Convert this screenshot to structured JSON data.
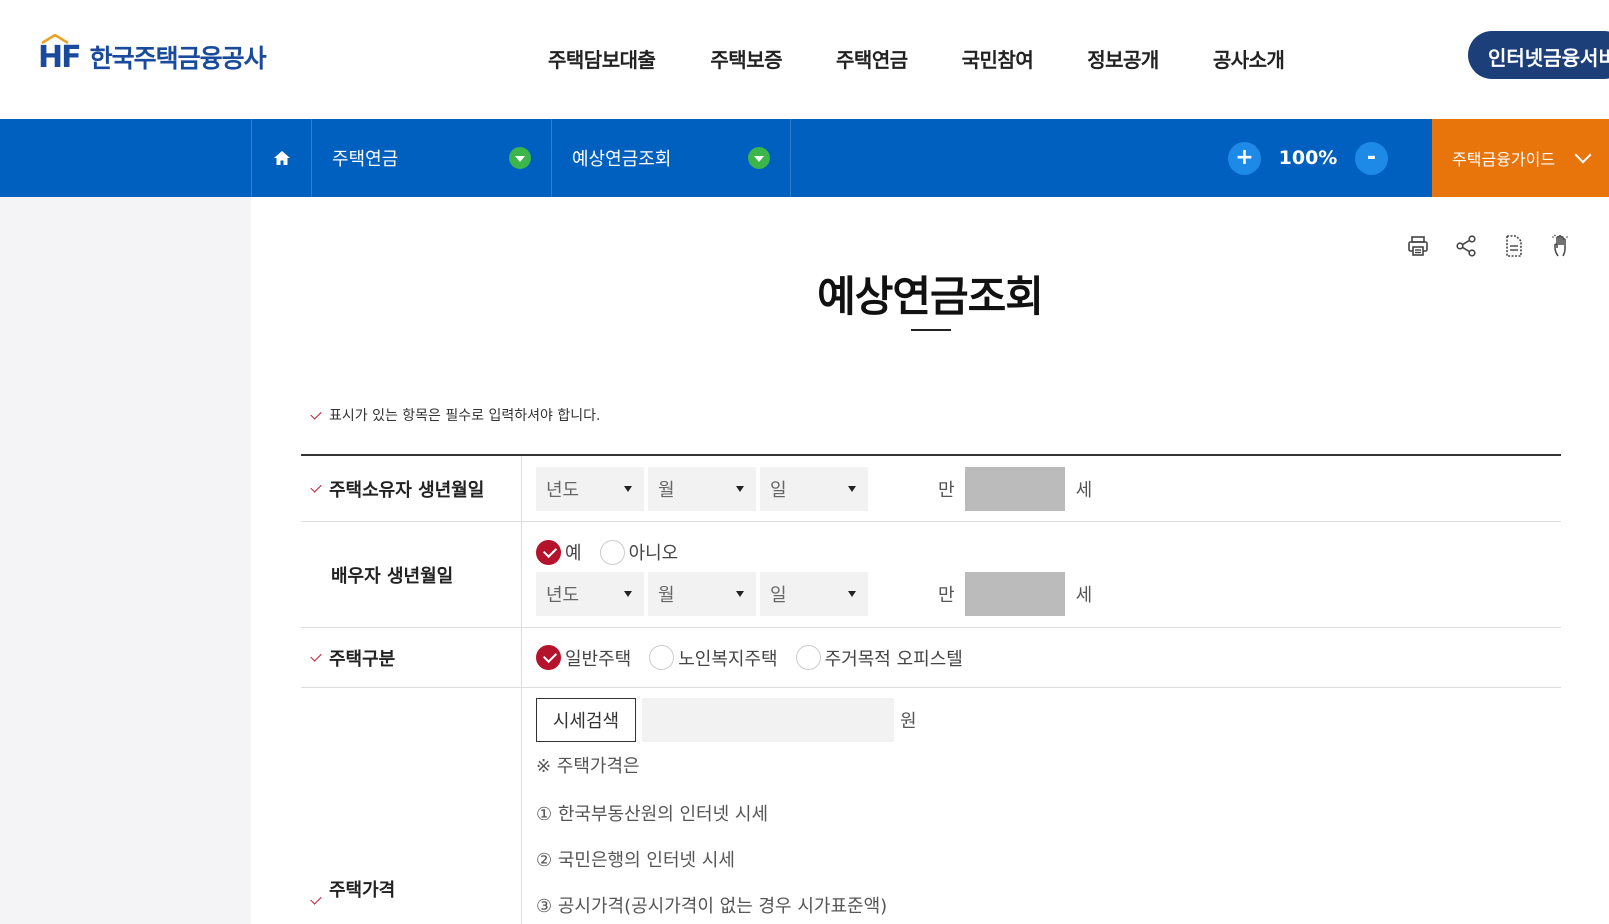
{
  "header": {
    "logo_mark": "HF",
    "logo_text": "한국주택금융공사",
    "nav": [
      "주택담보대출",
      "주택보증",
      "주택연금",
      "국민참여",
      "정보공개",
      "공사소개"
    ],
    "service_button": "인터넷금융서비스"
  },
  "locbar": {
    "menu1": "주택연금",
    "menu2": "예상연금조회",
    "zoom_in": "+",
    "zoom_value": "100%",
    "zoom_out": "-",
    "guide": "주택금융가이드"
  },
  "page": {
    "title": "예상연금조회",
    "required_note": "표시가 있는 항목은 필수로 입력하셔야 합니다."
  },
  "form": {
    "owner_birth": {
      "label": "주택소유자 생년월일",
      "year": "년도",
      "month": "월",
      "day": "일",
      "age_prefix": "만",
      "age_suffix": "세"
    },
    "spouse_birth": {
      "label": "배우자 생년월일",
      "radio_yes": "예",
      "radio_no": "아니오",
      "year": "년도",
      "month": "월",
      "day": "일",
      "age_prefix": "만",
      "age_suffix": "세"
    },
    "house_type": {
      "label": "주택구분",
      "options": [
        "일반주택",
        "노인복지주택",
        "주거목적 오피스텔"
      ]
    },
    "house_price": {
      "label": "주택가격",
      "search_button": "시세검색",
      "unit": "원",
      "note_title": "※ 주택가격은",
      "notes": [
        "① 한국부동산원의 인터넷 시세",
        "② 국민은행의 인터넷 시세",
        "③ 공시가격(공시가격이 없는 경우 시가표준액)"
      ]
    }
  },
  "colors": {
    "primary_blue": "#0060c0",
    "guide_orange": "#e8740c",
    "check_red": "#b5122b",
    "service_navy": "#1c3f7a"
  }
}
